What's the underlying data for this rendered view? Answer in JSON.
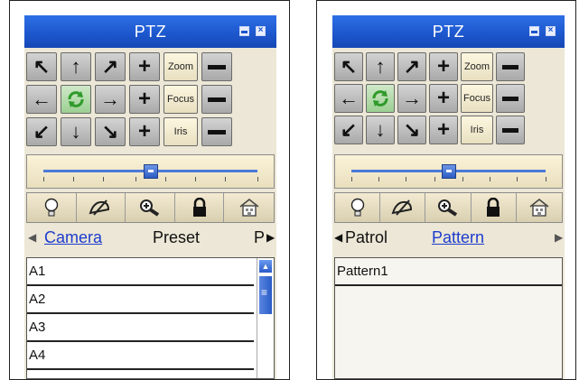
{
  "panels": [
    {
      "title": "PTZ",
      "buttons": {
        "zoom": "Zoom",
        "focus": "Focus",
        "iris": "Iris"
      },
      "tabs": {
        "left": "Camera",
        "middle": "Preset",
        "right": "P"
      },
      "active_tab": "Camera",
      "list": [
        "A1",
        "A2",
        "A3",
        "A4"
      ]
    },
    {
      "title": "PTZ",
      "buttons": {
        "zoom": "Zoom",
        "focus": "Focus",
        "iris": "Iris"
      },
      "tabs": {
        "left": "Patrol",
        "middle": "Pattern"
      },
      "active_tab": "Pattern",
      "list": [
        "Pattern1"
      ]
    }
  ],
  "speed_slider": {
    "value": 0.5
  },
  "icons": [
    "light-icon",
    "wiper-icon",
    "zoom-in-icon",
    "lock-icon",
    "home-icon"
  ],
  "colors": {
    "title_bar": "#1c56cc",
    "active_tab": "#1d3ccf",
    "panel_bg": "#ece7d6"
  }
}
